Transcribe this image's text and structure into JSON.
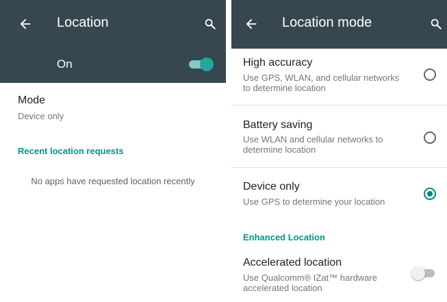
{
  "left": {
    "title": "Location",
    "switch_label": "On",
    "switch_on": true,
    "mode_title": "Mode",
    "mode_value": "Device only",
    "recent_header": "Recent location requests",
    "empty_message": "No apps have requested location recently"
  },
  "right": {
    "title": "Location mode",
    "options": [
      {
        "title": "High accuracy",
        "desc": "Use GPS, WLAN, and cellular networks to determine location",
        "selected": false
      },
      {
        "title": "Battery saving",
        "desc": "Use WLAN and cellular networks to determine location",
        "selected": false
      },
      {
        "title": "Device only",
        "desc": "Use GPS to determine your location",
        "selected": true
      }
    ],
    "enhanced_header": "Enhanced Location",
    "accelerated": {
      "title": "Accelerated location",
      "desc": "Use Qualcomm® IZat™ hardware accelerated location",
      "enabled": false
    }
  },
  "icons": [
    "back-arrow-icon",
    "search-icon",
    "toggle-switch",
    "radio-button"
  ],
  "colors": {
    "appbar": "#37474f",
    "accent": "#009688",
    "switch_on": "#26a69a"
  }
}
